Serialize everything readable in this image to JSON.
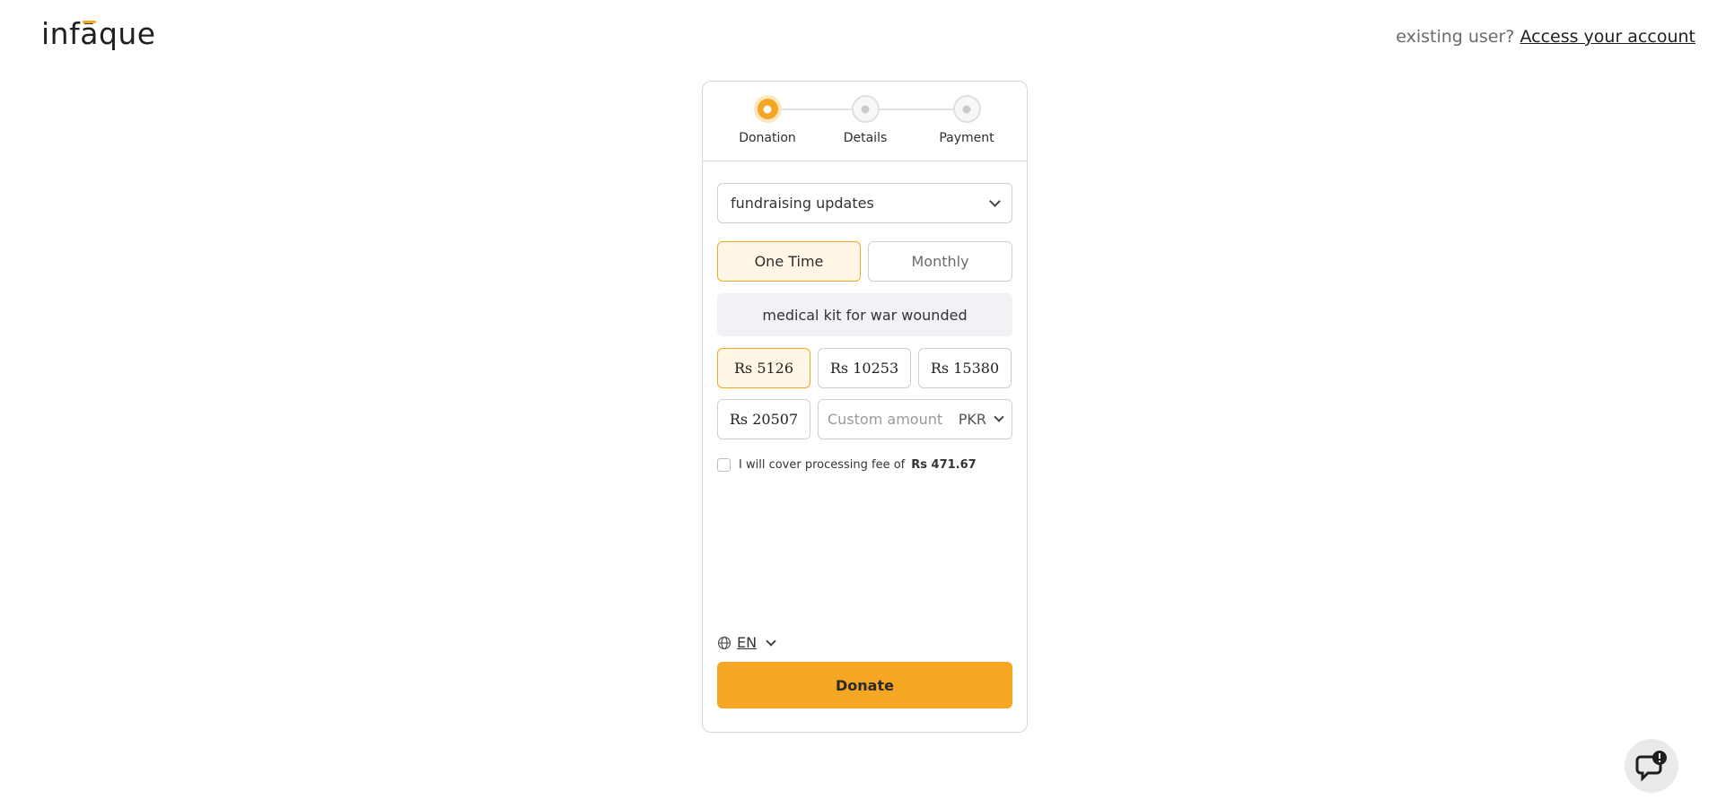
{
  "brand": {
    "logo_text": "infāque"
  },
  "header": {
    "existing_user_text": "existing user?",
    "access_link": "Access your account"
  },
  "stepper": {
    "steps": [
      {
        "label": "Donation",
        "active": true
      },
      {
        "label": "Details",
        "active": false
      },
      {
        "label": "Payment",
        "active": false
      }
    ]
  },
  "form": {
    "campaign_select": "fundraising updates",
    "frequency": {
      "one_time": "One Time",
      "monthly": "Monthly",
      "selected": "One Time"
    },
    "cause": "medical kit for war wounded",
    "amounts": [
      "Rs 5126",
      "Rs 10253",
      "Rs 15380",
      "Rs 20507"
    ],
    "selected_amount": "Rs 5126",
    "custom_amount": {
      "placeholder": "Custom amount",
      "value": ""
    },
    "currency": "PKR",
    "fee": {
      "text": "I will cover processing fee of",
      "amount": "Rs 471.67",
      "checked": false
    },
    "language": "EN",
    "donate_label": "Donate"
  },
  "colors": {
    "accent": "#f5a623",
    "accent_light": "#fff6e5",
    "cause_bg": "#f1f2f5"
  },
  "icons": [
    "globe-icon",
    "chevron-down-icon",
    "chat-support-icon"
  ]
}
